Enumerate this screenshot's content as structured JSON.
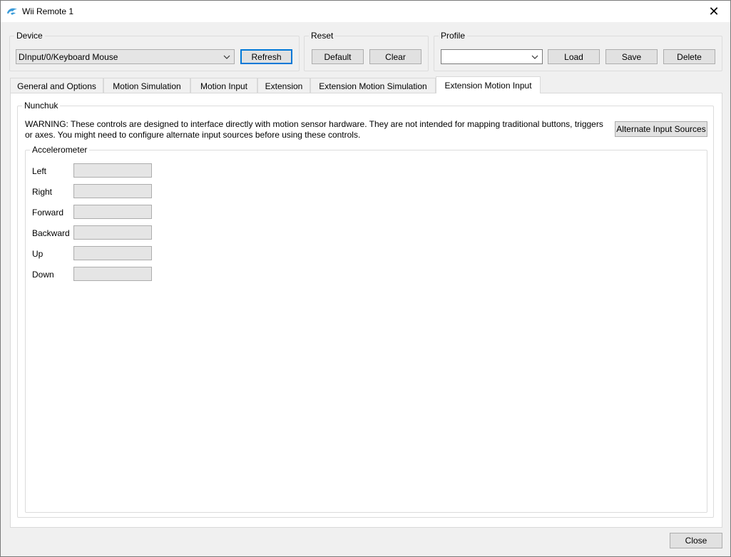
{
  "window": {
    "title": "Wii Remote 1",
    "close_glyph": "✕"
  },
  "device": {
    "legend": "Device",
    "selected": "DInput/0/Keyboard Mouse",
    "refresh_label": "Refresh"
  },
  "reset": {
    "legend": "Reset",
    "default_label": "Default",
    "clear_label": "Clear"
  },
  "profile": {
    "legend": "Profile",
    "selected": "",
    "load_label": "Load",
    "save_label": "Save",
    "delete_label": "Delete"
  },
  "tabs": [
    {
      "label": "General and Options"
    },
    {
      "label": "Motion Simulation"
    },
    {
      "label": "Motion Input"
    },
    {
      "label": "Extension"
    },
    {
      "label": "Extension Motion Simulation"
    },
    {
      "label": "Extension Motion Input",
      "active": true
    }
  ],
  "nunchuk": {
    "legend": "Nunchuk",
    "warning": "WARNING: These controls are designed to interface directly with motion sensor hardware. They are not intended for mapping traditional buttons, triggers or axes. You might need to configure alternate input sources before using these controls.",
    "alt_sources_label": "Alternate Input Sources",
    "accelerometer": {
      "legend": "Accelerometer",
      "rows": [
        {
          "label": "Left",
          "value": ""
        },
        {
          "label": "Right",
          "value": ""
        },
        {
          "label": "Forward",
          "value": ""
        },
        {
          "label": "Backward",
          "value": ""
        },
        {
          "label": "Up",
          "value": ""
        },
        {
          "label": "Down",
          "value": ""
        }
      ]
    }
  },
  "footer": {
    "close_label": "Close"
  },
  "colors": {
    "focus": "#0078d7",
    "icon": "#3a9bd9"
  },
  "icons": [
    "dolphin-icon",
    "close-icon",
    "chevron-down-icon"
  ]
}
